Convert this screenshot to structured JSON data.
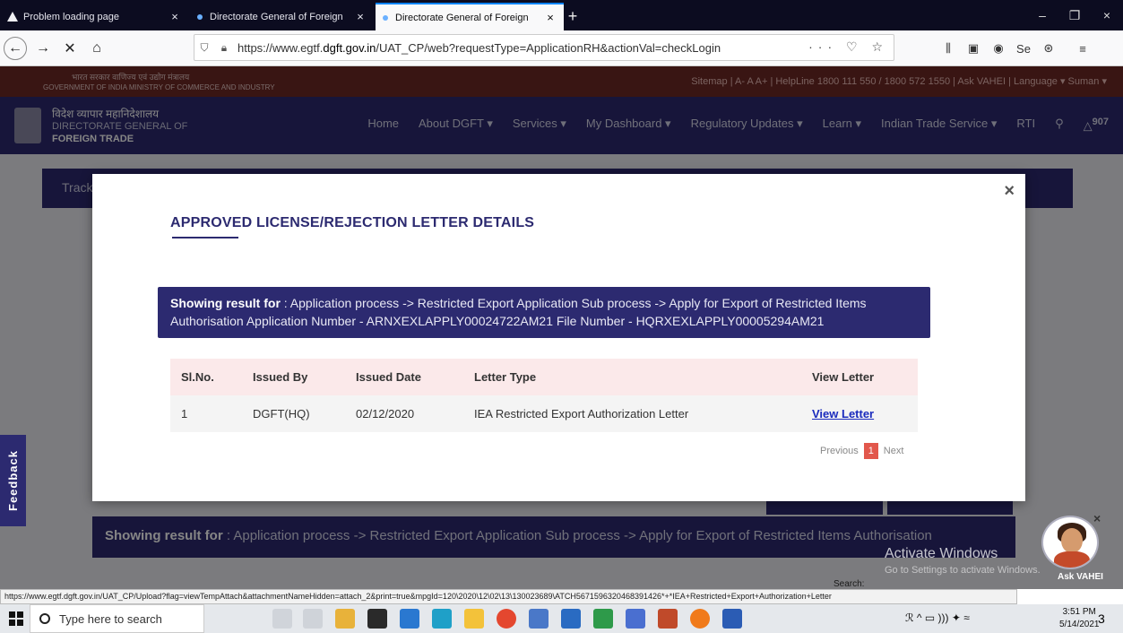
{
  "browser": {
    "tabs": [
      {
        "title": "Problem loading page",
        "close": "×"
      },
      {
        "title": "Directorate General of Foreign",
        "close": "×"
      },
      {
        "title": "Directorate General of Foreign",
        "close": "×"
      }
    ],
    "new_tab": "+",
    "window_controls": {
      "minimize": "–",
      "restore": "❐",
      "close": "×"
    },
    "nav": {
      "back": "←",
      "forward": "→",
      "stop": "✕",
      "home": "⌂"
    },
    "url_prefix": "https://www.egtf.",
    "url_domain": "dgft.gov.in",
    "url_suffix": "/UAT_CP/web?requestType=ApplicationRH&actionVal=checkLogin",
    "url_actions": "··· ♡ ☆",
    "status_url": "https://www.egtf.dgft.gov.in/UAT_CP/Upload?flag=viewTempAttach&attachmentNameHidden=attach_2&print=true&mpgId=120\\2020\\12\\02\\13\\130023689\\ATCH5671596320468391426*+*IEA+Restricted+Export+Authorization+Letter"
  },
  "site": {
    "gov_hindi": "भारत सरकार  वाणिज्य एवं उद्योग मंत्रालय",
    "gov_english": "GOVERNMENT OF INDIA  MINISTRY OF COMMERCE AND INDUSTRY",
    "top_links": "Sitemap  |  A-   A   A+  |  HelpLine  1800 111 550 /   1800 572 1550  |  Ask VAHEI  |  Language ▾   Suman ▾",
    "org_hindi": "विदेश व्यापार महानिदेशालय",
    "org_line1": "DIRECTORATE GENERAL OF",
    "org_line2": "FOREIGN TRADE",
    "menu": [
      "Home",
      "About DGFT ▾",
      "Services ▾",
      "My Dashboard ▾",
      "Regulatory Updates ▾",
      "Learn ▾",
      "Indian Trade Service ▾",
      "RTI"
    ],
    "notifications": "907",
    "track_label": "Track",
    "bg_result_label": "Showing result for",
    "bg_result_text": " : Application process -> Restricted Export Application Sub process -> Apply for Export of Restricted Items Authorisation",
    "search_label": "Search:",
    "feedback": "Feedback",
    "ask_vahei": "Ask VAHEI",
    "activate_title": "Activate Windows",
    "activate_sub": "Go to Settings to activate Windows."
  },
  "modal": {
    "title": "APPROVED LICENSE/REJECTION LETTER DETAILS",
    "close": "×",
    "result_label": "Showing result for",
    "result_text": " : Application process -> Restricted Export Application Sub process -> Apply for Export of Restricted Items Authorisation Application Number - ARNXEXLAPPLY00024722AM21 File Number - HQRXEXLAPPLY00005294AM21",
    "table": {
      "headers": [
        "Sl.No.",
        "Issued By",
        "Issued Date",
        "Letter Type",
        "View Letter"
      ],
      "rows": [
        [
          "1",
          "DGFT(HQ)",
          "02/12/2020",
          "IEA Restricted Export Authorization Letter",
          "View Letter"
        ]
      ]
    },
    "pager": {
      "previous": "Previous",
      "current": "1",
      "next": "Next"
    }
  },
  "taskbar": {
    "search_placeholder": "Type here to search",
    "tray": "ℛ  ^  ▭  ))) ✦  ≈",
    "time": "3:51 PM",
    "date": "5/14/2021",
    "notif": "3"
  }
}
